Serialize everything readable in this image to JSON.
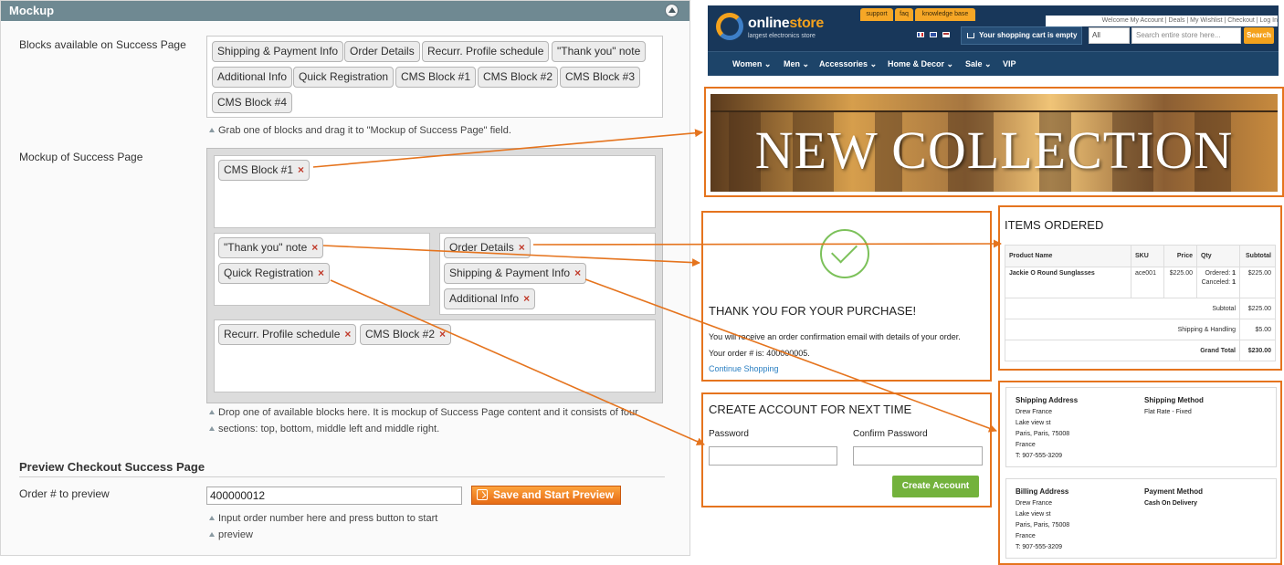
{
  "section": {
    "title": "Mockup"
  },
  "available": {
    "label": "Blocks available on Success Page",
    "chips": [
      "Shipping & Payment Info",
      "Order Details",
      "Recurr. Profile schedule",
      "\"Thank you\" note",
      "Additional Info",
      "Quick Registration",
      "CMS Block #1",
      "CMS Block #2",
      "CMS Block #3",
      "CMS Block #4"
    ],
    "hint": "Grab one of blocks and drag it to \"Mockup of Success Page\" field."
  },
  "mockup": {
    "label": "Mockup of Success Page",
    "top": [
      "CMS Block #1"
    ],
    "middle_left": [
      "\"Thank you\" note",
      "Quick Registration"
    ],
    "middle_right": [
      "Order Details",
      "Shipping & Payment Info",
      "Additional Info"
    ],
    "bottom": [
      "Recurr. Profile schedule",
      "CMS Block #2"
    ],
    "remove_glyph": "×",
    "hint_line1": "Drop one of available blocks here. It is mockup of Success Page content and it consists of four",
    "hint_line2": "sections: top, bottom, middle left and middle right."
  },
  "preview": {
    "title": "Preview Checkout Success Page",
    "order_label": "Order # to preview",
    "order_value": "400000012",
    "button": "Save and Start Preview",
    "hint_line1": "Input order number here and press button to start",
    "hint_line2": "preview"
  },
  "store": {
    "logo_part1": "online",
    "logo_part2": "store",
    "tagline": "largest electronics store",
    "top_tabs": [
      "support",
      "faq",
      "knowledge base"
    ],
    "top_links": "Welcome   My Account | Deals | My Wishlist | Checkout | Log In",
    "cart": "Your shopping cart is empty",
    "search_scope": "All",
    "search_placeholder": "Search entire store here...",
    "search_button": "Search",
    "nav": [
      "Women",
      "Men",
      "Accessories",
      "Home & Decor",
      "Sale",
      "VIP"
    ],
    "nav_chevron": "⌄"
  },
  "banner": {
    "title": "NEW COLLECTION"
  },
  "thankyou": {
    "title": "THANK YOU FOR YOUR PURCHASE!",
    "line1": "You will receive an order confirmation email with details of your order.",
    "line2": "Your order # is: 400000005.",
    "link": "Continue Shopping"
  },
  "create_account": {
    "title": "CREATE ACCOUNT FOR NEXT TIME",
    "password_label": "Password",
    "confirm_label": "Confirm Password",
    "button": "Create Account"
  },
  "items": {
    "title": "ITEMS ORDERED",
    "headers": [
      "Product Name",
      "SKU",
      "Price",
      "Qty",
      "Subtotal"
    ],
    "row": {
      "name": "Jackie O Round Sunglasses",
      "sku": "ace001",
      "price": "$225.00",
      "ordered_label": "Ordered:",
      "ordered": "1",
      "canceled_label": "Canceled:",
      "canceled": "1",
      "subtotal": "$225.00"
    },
    "totals": [
      {
        "label": "Subtotal",
        "value": "$225.00"
      },
      {
        "label": "Shipping & Handling",
        "value": "$5.00"
      },
      {
        "label": "Grand Total",
        "value": "$230.00"
      }
    ]
  },
  "shipping": {
    "address_title": "Shipping Address",
    "address": [
      "Drew France",
      "Lake view st",
      "Paris, Paris, 75008",
      "France",
      "T: 907-555-3209"
    ],
    "method_title": "Shipping Method",
    "method": "Flat Rate - Fixed"
  },
  "billing": {
    "address_title": "Billing Address",
    "address": [
      "Drew France",
      "Lake view st",
      "Paris, Paris, 75008",
      "France",
      "T: 907-555-3209"
    ],
    "method_title": "Payment Method",
    "method": "Cash On Delivery"
  },
  "colors": {
    "accent_orange": "#e5741e",
    "admin_header": "#6f8992",
    "store_navy": "#18375a",
    "green": "#73b23c",
    "remove_red": "#c13b2b"
  }
}
